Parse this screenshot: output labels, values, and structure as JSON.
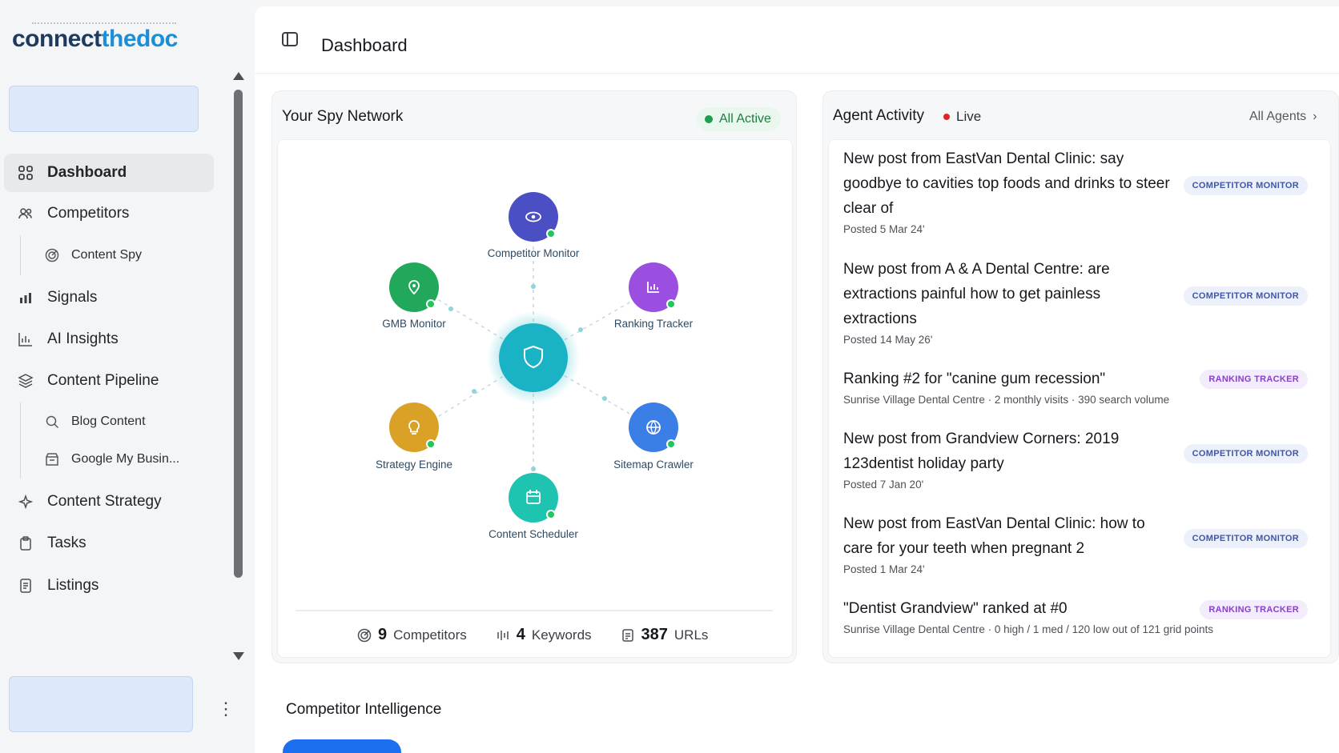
{
  "app": {
    "logo_part1": "connect",
    "logo_part2": "thedoc"
  },
  "sidebar": {
    "items": [
      {
        "label": "Dashboard",
        "icon": "grid-icon"
      },
      {
        "label": "Competitors",
        "icon": "users-icon"
      },
      {
        "label": "Content Spy",
        "icon": "target-icon"
      },
      {
        "label": "Signals",
        "icon": "bar-chart-icon"
      },
      {
        "label": "AI Insights",
        "icon": "chart-icon"
      },
      {
        "label": "Content Pipeline",
        "icon": "layers-icon"
      },
      {
        "label": "Blog Content",
        "icon": "search-icon"
      },
      {
        "label": "Google My Busin...",
        "icon": "store-icon"
      },
      {
        "label": "Content Strategy",
        "icon": "sparkle-icon"
      },
      {
        "label": "Tasks",
        "icon": "clipboard-icon"
      },
      {
        "label": "Listings",
        "icon": "document-icon"
      }
    ]
  },
  "header": {
    "title": "Dashboard"
  },
  "spy_network": {
    "title": "Your Spy Network",
    "status": "All Active",
    "status_color": "#1e9e4f",
    "nodes": [
      {
        "label": "Competitor Monitor",
        "icon": "eye-icon",
        "color": "#4b4fc4"
      },
      {
        "label": "GMB Monitor",
        "icon": "pin-icon",
        "color": "#22a85a"
      },
      {
        "label": "Ranking Tracker",
        "icon": "chart-icon",
        "color": "#9b4fe0"
      },
      {
        "label": "Strategy Engine",
        "icon": "lightbulb-icon",
        "color": "#d9a126"
      },
      {
        "label": "Sitemap Crawler",
        "icon": "globe-icon",
        "color": "#3a7ee6"
      },
      {
        "label": "Content Scheduler",
        "icon": "calendar-icon",
        "color": "#1fc4b0"
      }
    ],
    "center_icon": "shield-icon",
    "stats": [
      {
        "value": "9",
        "label": "Competitors"
      },
      {
        "value": "4",
        "label": "Keywords"
      },
      {
        "value": "387",
        "label": "URLs"
      }
    ]
  },
  "agent_activity": {
    "title": "Agent Activity",
    "live_label": "Live",
    "all_agents": "All Agents",
    "items": [
      {
        "headline": "New post from EastVan Dental Clinic: say goodbye to cavities top foods and drinks to steer clear of",
        "sub": "Posted 5 Mar 24'",
        "tag": "COMPETITOR MONITOR"
      },
      {
        "headline": "New post from A & A Dental Centre: are extractions painful how to get painless extractions",
        "sub": "Posted 14 May 26'",
        "tag": "COMPETITOR MONITOR"
      },
      {
        "headline": "Ranking #2 for \"canine gum recession\"",
        "sub": "Sunrise Village Dental Centre · 2 monthly visits · 390 search volume",
        "tag": "RANKING TRACKER"
      },
      {
        "headline": "New post from Grandview Corners: 2019 123dentist holiday party",
        "sub": "Posted 7 Jan 20'",
        "tag": "COMPETITOR MONITOR"
      },
      {
        "headline": "New post from EastVan Dental Clinic: how to care for your teeth when pregnant 2",
        "sub": "Posted 1 Mar 24'",
        "tag": "COMPETITOR MONITOR"
      },
      {
        "headline": "\"Dentist Grandview\" ranked at #0",
        "sub": "Sunrise Village Dental Centre · 0 high / 1 med / 120 low out of 121 grid points",
        "tag": "RANKING TRACKER"
      }
    ]
  },
  "competitor_intelligence": {
    "title": "Competitor Intelligence"
  }
}
